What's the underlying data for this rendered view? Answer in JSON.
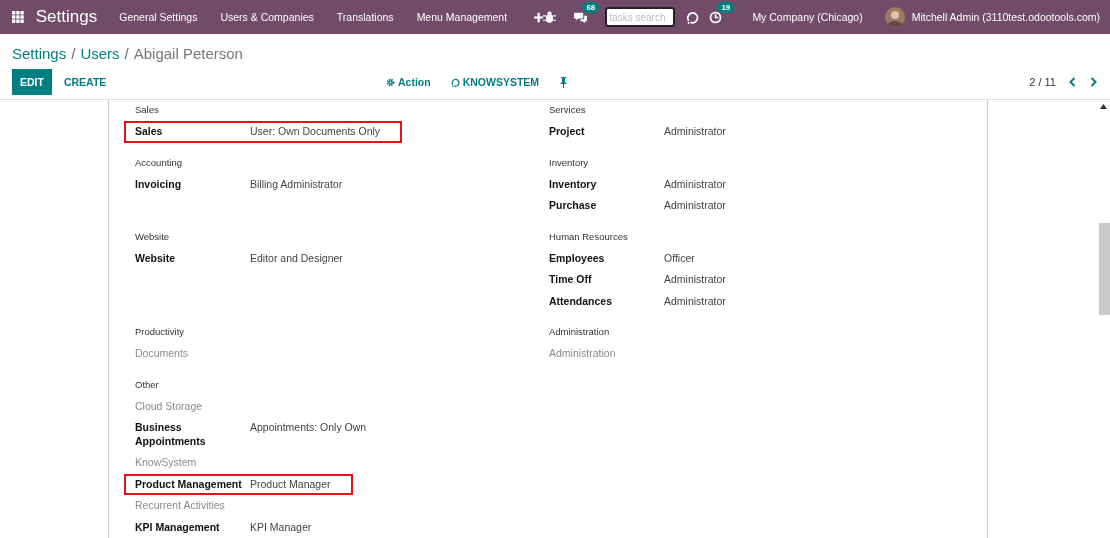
{
  "navbar": {
    "app_title": "Settings",
    "menu": [
      "General Settings",
      "Users & Companies",
      "Translations",
      "Menu Management"
    ],
    "messages_badge": "68",
    "search": {
      "placeholder": "tasks search"
    },
    "activities_badge": "19",
    "company": "My Company (Chicago)",
    "user": "Mitchell Admin (3110test.odootools.com)"
  },
  "breadcrumb": [
    {
      "label": "Settings",
      "kind": "link"
    },
    {
      "label": "/",
      "kind": "separator"
    },
    {
      "label": "Users",
      "kind": "link"
    },
    {
      "label": "/",
      "kind": "separator"
    },
    {
      "label": "Abigail Peterson",
      "kind": "current"
    }
  ],
  "buttons": [
    {
      "label": "EDIT",
      "kind": "primary"
    },
    {
      "label": "CREATE",
      "kind": "secondary"
    }
  ],
  "actions": [
    {
      "label": "Action",
      "kind": "gear"
    },
    {
      "label": "KNOWSYSTEM",
      "kind": "knowsystem"
    }
  ],
  "pager": "2 / 11",
  "groups": [
    {
      "title": "Sales",
      "rows": [
        {
          "label": "Sales",
          "value": "User: Own Documents Only",
          "enabled": true,
          "highlighted": true
        }
      ]
    },
    {
      "title": "Services",
      "rows": [
        {
          "label": "Project",
          "value": "Administrator",
          "enabled": true,
          "highlighted": false
        }
      ]
    },
    {
      "title": "Accounting",
      "rows": [
        {
          "label": "Invoicing",
          "value": "Billing Administrator",
          "enabled": true,
          "highlighted": false
        }
      ]
    },
    {
      "title": "Inventory",
      "rows": [
        {
          "label": "Inventory",
          "value": "Administrator",
          "enabled": true,
          "highlighted": false
        },
        {
          "label": "Purchase",
          "value": "Administrator",
          "enabled": true,
          "highlighted": false
        }
      ]
    },
    {
      "title": "Website",
      "rows": [
        {
          "label": "Website",
          "value": "Editor and Designer",
          "enabled": true,
          "highlighted": false
        }
      ]
    },
    {
      "title": "Human Resources",
      "rows": [
        {
          "label": "Employees",
          "value": "Officer",
          "enabled": true,
          "highlighted": false
        },
        {
          "label": "Time Off",
          "value": "Administrator",
          "enabled": true,
          "highlighted": false
        },
        {
          "label": "Attendances",
          "value": "Administrator",
          "enabled": true,
          "highlighted": false
        }
      ]
    },
    {
      "title": "Productivity",
      "rows": [
        {
          "label": "Documents",
          "enabled": false,
          "highlighted": false
        }
      ]
    },
    {
      "title": "Administration",
      "rows": [
        {
          "label": "Administration",
          "enabled": false,
          "highlighted": false
        }
      ]
    },
    {
      "title": "Other",
      "rows": [
        {
          "label": "Cloud Storage",
          "enabled": false,
          "highlighted": false
        },
        {
          "label": "Business Appointments",
          "value": "Appointments: Only Own",
          "enabled": true,
          "highlighted": false
        },
        {
          "label": "KnowSystem",
          "enabled": false,
          "highlighted": false
        },
        {
          "label": "Product Management",
          "value": "Product Manager",
          "enabled": true,
          "highlighted": true
        },
        {
          "label": "Recurrent Activities",
          "enabled": false,
          "highlighted": false
        },
        {
          "label": "KPI Management",
          "value": "KPI Manager",
          "enabled": true,
          "highlighted": false
        }
      ]
    }
  ]
}
